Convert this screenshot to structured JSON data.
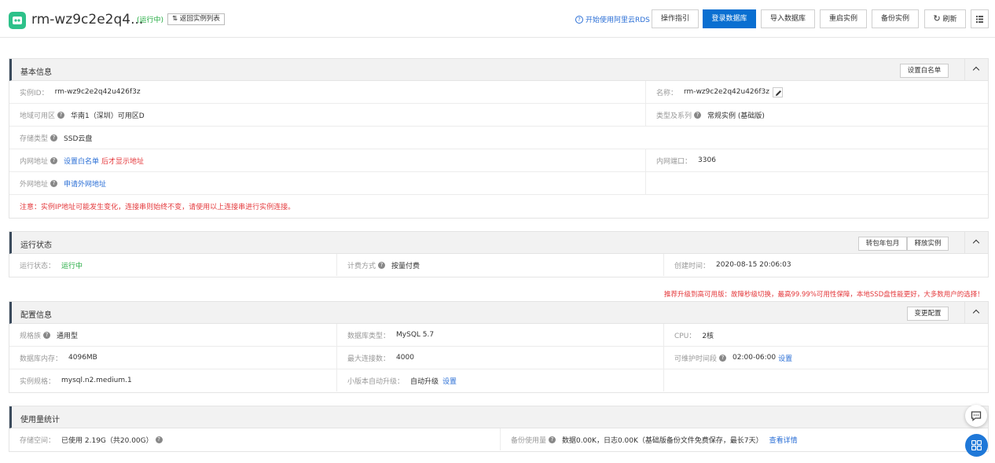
{
  "header": {
    "title": "rm-wz9c2e2q4...",
    "status": "(运行中)",
    "back_label": "返回实例列表",
    "back_icon": "return-icon",
    "rds_link": "开始使用阿里云RDS",
    "buttons": {
      "guide": "操作指引",
      "login_db": "登录数据库",
      "import_db": "导入数据库",
      "restart": "重启实例",
      "backup": "备份实例",
      "refresh": "刷新"
    },
    "primary_color": "#0a6fd1",
    "logo_color": "#2ec18a"
  },
  "basic": {
    "title": "基本信息",
    "whitelist_btn": "设置白名单",
    "instance_id_label": "实例ID：",
    "instance_id": "rm-wz9c2e2q42u426f3z",
    "name_label": "名称：",
    "name": "rm-wz9c2e2q42u426f3z",
    "zone_label": "地域可用区",
    "zone": "华南1（深圳）可用区D",
    "type_label": "类型及系列",
    "type": "常规实例 (基础版)",
    "storage_label": "存储类型",
    "storage": "SSD云盘",
    "intranet_label": "内网地址",
    "intranet_link": "设置白名单",
    "intranet_suffix": "后才显示地址",
    "port_label": "内网端口：",
    "port": "3306",
    "internet_label": "外网地址",
    "internet_link": "申请外网地址",
    "notice": "注意：实例IP地址可能发生变化，连接串则始终不变，请使用以上连接串进行实例连接。"
  },
  "running": {
    "title": "运行状态",
    "btn_monthly": "转包年包月",
    "btn_release": "释放实例",
    "status_label": "运行状态：",
    "status": "运行中",
    "billing_label": "计费方式",
    "billing": "按量付费",
    "created_label": "创建时间：",
    "created": "2020-08-15 20:06:03"
  },
  "promo": "推荐升级到高可用版：故障秒级切换，最高99.99%可用性保障，本地SSD盘性能更好，大多数用户的选择！",
  "config": {
    "title": "配置信息",
    "change_btn": "变更配置",
    "family_label": "规格族",
    "family": "通用型",
    "dbtype_label": "数据库类型：",
    "dbtype": "MySQL 5.7",
    "cpu_label": "CPU：",
    "cpu": "2核",
    "memory_label": "数据库内存：",
    "memory": "4096MB",
    "maxconn_label": "最大连接数：",
    "maxconn": "4000",
    "maint_label": "可维护时间段",
    "maint": "02:00-06:00",
    "maint_link": "设置",
    "spec_label": "实例规格：",
    "spec": "mysql.n2.medium.1",
    "minor_label": "小版本自动升级：",
    "minor": "自动升级",
    "minor_link": "设置"
  },
  "usage": {
    "title": "使用量统计",
    "storage_label": "存储空间：",
    "storage": "已使用 2.19G（共20.00G）",
    "backup_label": "备份使用量",
    "backup": "数据0.00K，日志0.00K（基础版备份文件免费保存，最长7天）",
    "backup_link": "查看详情"
  },
  "icons": {
    "help": "?",
    "rds_help": "?"
  }
}
